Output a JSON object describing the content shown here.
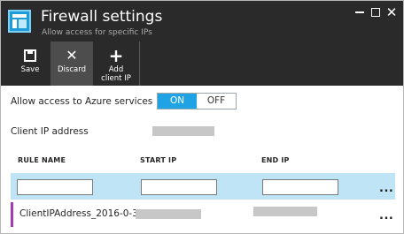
{
  "header": {
    "title": "Firewall settings",
    "subtitle": "Allow access for specific IPs"
  },
  "toolbar": {
    "save_label": "Save",
    "discard_label": "Discard",
    "add_client_ip_label": "Add client IP"
  },
  "azure_access": {
    "label": "Allow access to Azure services",
    "options": [
      "ON",
      "OFF"
    ],
    "selected": "ON"
  },
  "client_ip": {
    "label": "Client IP address"
  },
  "rules_table": {
    "columns": [
      "RULE NAME",
      "START IP",
      "END IP"
    ],
    "new_row": {
      "rule_name": "",
      "start_ip": "",
      "end_ip": "",
      "more_label": "..."
    },
    "rows": [
      {
        "rule_name": "ClientIPAddress_2016-0-3_1...",
        "more_label": "..."
      }
    ]
  },
  "colors": {
    "header_bg": "#2a2a2a",
    "accent": "#1fa3e4",
    "selected_row_bg": "#bfe4f6",
    "rule_marker": "#a43ab5"
  }
}
